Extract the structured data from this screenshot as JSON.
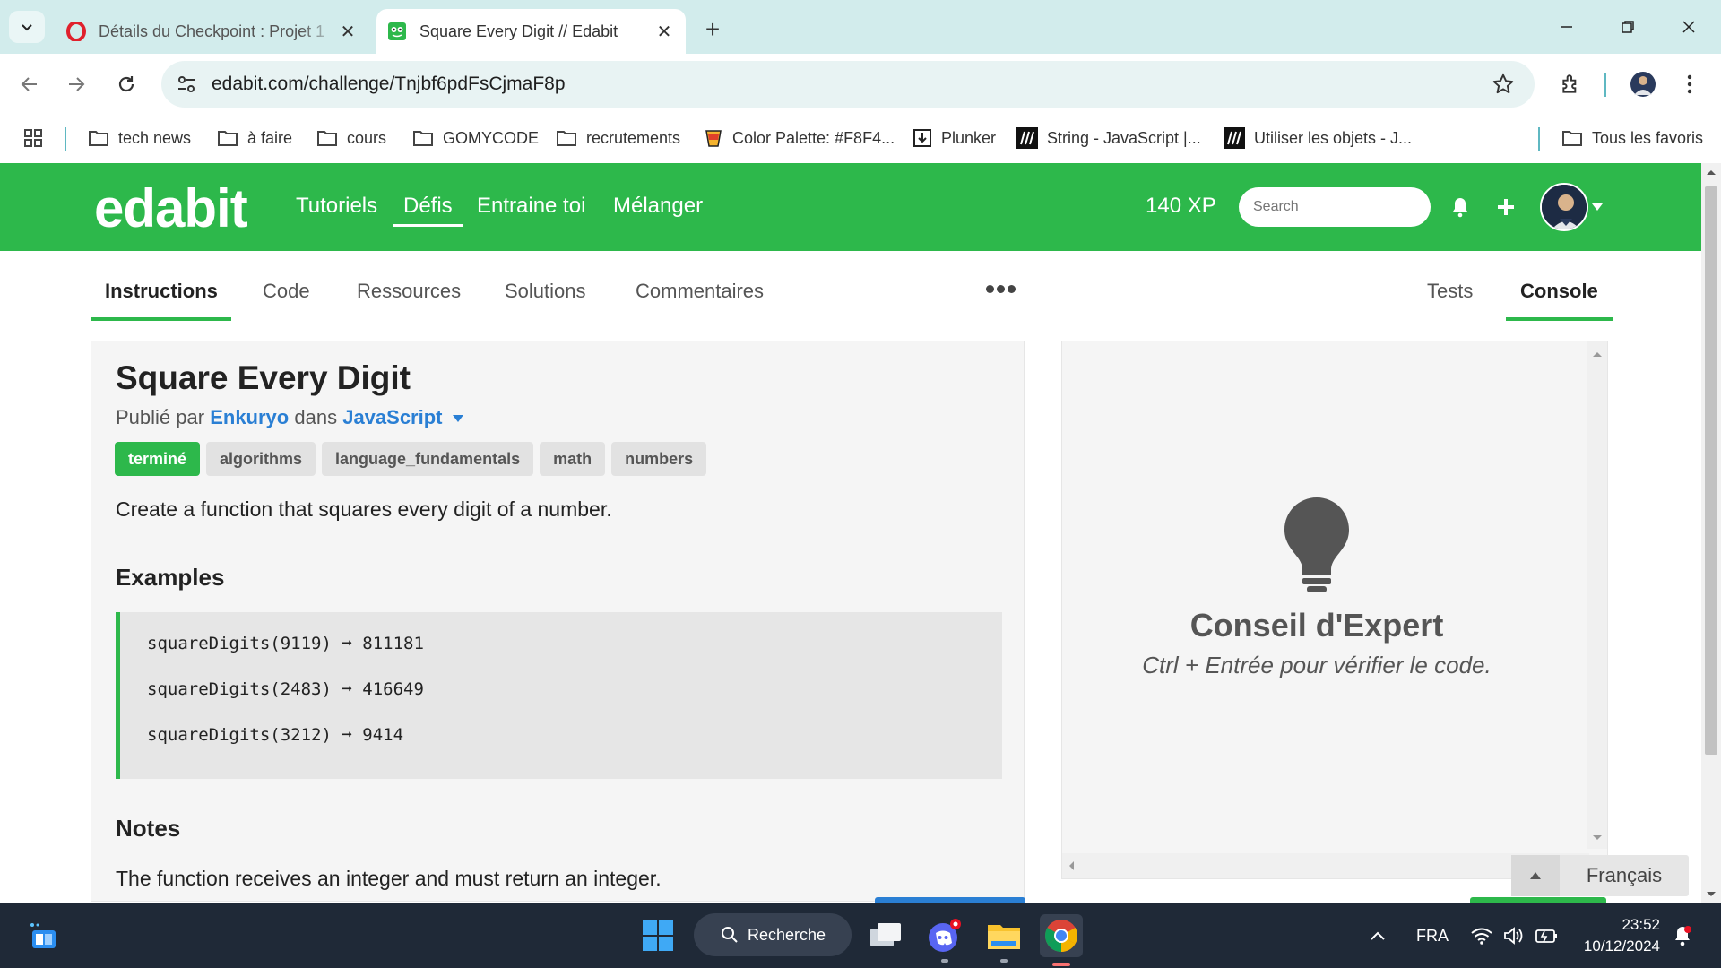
{
  "browser": {
    "tabs": [
      {
        "title": "Détails du Checkpoint : Projet 1",
        "active": false
      },
      {
        "title": "Square Every Digit // Edabit",
        "active": true
      }
    ],
    "url": "edabit.com/challenge/Tnjbf6pdFsCjmaF8p",
    "bookmarks": [
      {
        "label": "tech news",
        "icon": "folder-icon"
      },
      {
        "label": "à faire",
        "icon": "folder-icon"
      },
      {
        "label": "cours",
        "icon": "folder-icon"
      },
      {
        "label": "GOMYCODE",
        "icon": "folder-icon"
      },
      {
        "label": "recrutements",
        "icon": "folder-icon"
      },
      {
        "label": "Color Palette: #F8F4...",
        "icon": "palette-icon"
      },
      {
        "label": "Plunker",
        "icon": "download-icon"
      },
      {
        "label": "String - JavaScript |...",
        "icon": "mdn-icon"
      },
      {
        "label": "Utiliser les objets - J...",
        "icon": "mdn-icon"
      }
    ],
    "all_bookmarks": "Tous les favoris"
  },
  "site": {
    "logo": "edabit",
    "nav": [
      "Tutoriels",
      "Défis",
      "Entraine toi",
      "Mélanger"
    ],
    "active_nav": "Défis",
    "xp": "140 XP",
    "search_placeholder": "Search",
    "brand_color": "#2db84b"
  },
  "subtabs": {
    "left": [
      "Instructions",
      "Code",
      "Ressources",
      "Solutions",
      "Commentaires"
    ],
    "right": [
      "Tests",
      "Console"
    ],
    "active_left": "Instructions",
    "active_right": "Console"
  },
  "challenge": {
    "title": "Square Every Digit",
    "published_by": "Publié par",
    "author": "Enkuryo",
    "in": "dans",
    "language": "JavaScript",
    "tags": [
      "terminé",
      "algorithms",
      "language_fundamentals",
      "math",
      "numbers"
    ],
    "description": "Create a function that squares every digit of a number.",
    "examples_heading": "Examples",
    "examples": [
      {
        "call": "squareDigits(9119)",
        "arrow": "➞",
        "result": "811181"
      },
      {
        "call": "squareDigits(2483)",
        "arrow": "➞",
        "result": "416649"
      },
      {
        "call": "squareDigits(3212)",
        "arrow": "➞",
        "result": "9414"
      }
    ],
    "notes_heading": "Notes",
    "notes": "The function receives an integer and must return an integer."
  },
  "console": {
    "tip_title": "Conseil d'Expert",
    "tip_text": "Ctrl + Entrée pour vérifier le code."
  },
  "language_button": "Français",
  "taskbar": {
    "search": "Recherche",
    "lang": "FRA",
    "time": "23:52",
    "date": "10/12/2024"
  }
}
